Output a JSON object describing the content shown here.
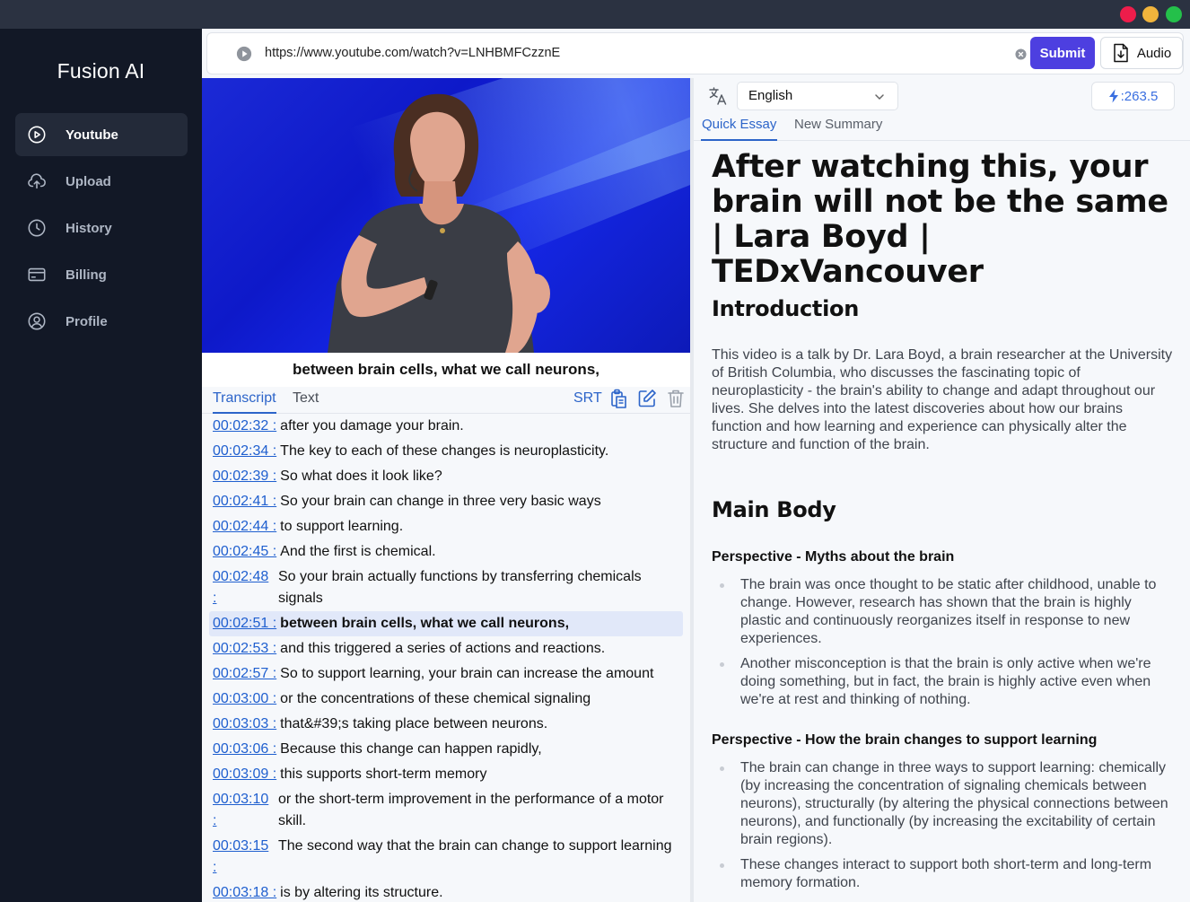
{
  "window": {
    "traffic_lights": [
      "#ee1d4b",
      "#f1b43c",
      "#24c04a"
    ]
  },
  "sidebar": {
    "brand": "Fusion AI",
    "items": [
      {
        "label": "Youtube",
        "icon": "play-circle-icon",
        "active": true
      },
      {
        "label": "Upload",
        "icon": "cloud-upload-icon",
        "active": false
      },
      {
        "label": "History",
        "icon": "clock-icon",
        "active": false
      },
      {
        "label": "Billing",
        "icon": "credit-card-icon",
        "active": false
      },
      {
        "label": "Profile",
        "icon": "user-circle-icon",
        "active": false
      }
    ]
  },
  "urlbar": {
    "value": "https://www.youtube.com/watch?v=LNHBMFCzznE",
    "submit_label": "Submit",
    "audio_label": "Audio"
  },
  "video": {
    "caption": "between brain cells, what we call neurons,"
  },
  "left_tabs": {
    "transcript": "Transcript",
    "text": "Text",
    "srt": "SRT"
  },
  "transcript": [
    {
      "time": "00:02:32 :",
      "text": "after you damage your brain."
    },
    {
      "time": "00:02:34 :",
      "text": "The key to each of these changes is neuroplasticity."
    },
    {
      "time": "00:02:39 :",
      "text": "So what does it look like?"
    },
    {
      "time": "00:02:41 :",
      "text": "So your brain can change in three very basic ways"
    },
    {
      "time": "00:02:44 :",
      "text": "to support learning."
    },
    {
      "time": "00:02:45 :",
      "text": "And the first is chemical."
    },
    {
      "time": "00:02:48 :",
      "text": "So your brain actually functions by transferring chemicals signals"
    },
    {
      "time": "00:02:51 :",
      "text": "between brain cells, what we call neurons,",
      "highlight": true
    },
    {
      "time": "00:02:53 :",
      "text": "and this triggered a series of actions and reactions."
    },
    {
      "time": "00:02:57 :",
      "text": "So to support learning, your brain can increase the amount"
    },
    {
      "time": "00:03:00 :",
      "text": "or the concentrations of these chemical signaling"
    },
    {
      "time": "00:03:03 :",
      "text": "that&#39;s taking place between neurons."
    },
    {
      "time": "00:03:06 :",
      "text": "Because this change can happen rapidly,"
    },
    {
      "time": "00:03:09 :",
      "text": "this supports short-term memory"
    },
    {
      "time": "00:03:10 :",
      "text": "or the short-term improvement in the performance of a motor skill."
    },
    {
      "time": "00:03:15 :",
      "text": "The second way that the brain can change to support learning"
    },
    {
      "time": "00:03:18 :",
      "text": "is by altering its structure."
    }
  ],
  "right": {
    "language": "English",
    "credits": ":263.5",
    "tabs": {
      "quick_essay": "Quick Essay",
      "new_summary": "New Summary"
    },
    "title": "After watching this, your brain will not be the same | Lara Boyd | TEDxVancouver",
    "intro_heading": "Introduction",
    "intro_text": "This video is a talk by Dr. Lara Boyd, a brain researcher at the University of British Columbia, who discusses the fascinating topic of neuroplasticity - the brain's ability to change and adapt throughout our lives. She delves into the latest discoveries about how our brains function and how learning and experience can physically alter the structure and function of the brain.",
    "main_heading": "Main Body",
    "perspective1": {
      "title": "Perspective - Myths about the brain",
      "points": [
        "The brain was once thought to be static after childhood, unable to change. However, research has shown that the brain is highly plastic and continuously reorganizes itself in response to new experiences.",
        "Another misconception is that the brain is only active when we're doing something, but in fact, the brain is highly active even when we're at rest and thinking of nothing."
      ]
    },
    "perspective2": {
      "title": "Perspective - How the brain changes to support learning",
      "points": [
        "The brain can change in three ways to support learning: chemically (by increasing the concentration of signaling chemicals between neurons), structurally (by altering the physical connections between neurons), and functionally (by increasing the excitability of certain brain regions).",
        "These changes interact to support both short-term and long-term memory formation."
      ]
    }
  }
}
